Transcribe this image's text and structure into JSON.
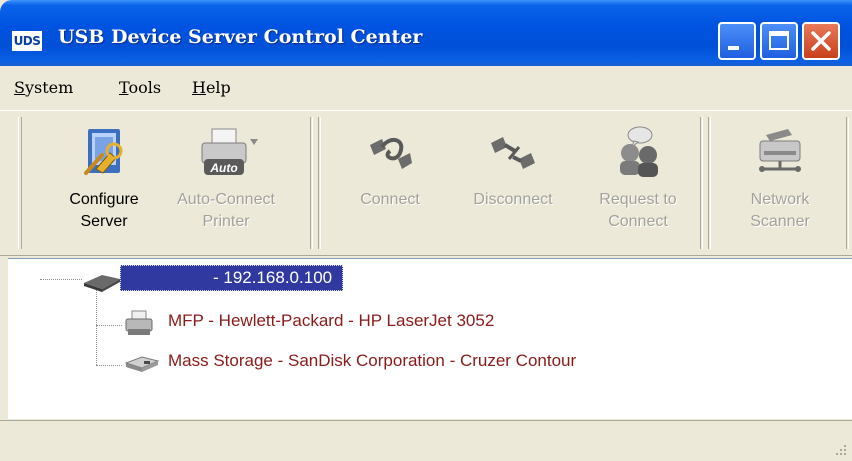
{
  "window": {
    "app_icon_text": "UDS",
    "title": "USB Device Server Control Center",
    "controls": {
      "minimize": "minimize-icon",
      "maximize": "maximize-icon",
      "close": "close-icon"
    }
  },
  "menu": {
    "items": [
      {
        "label": "System",
        "accel": "S",
        "rest": "ystem"
      },
      {
        "label": "Tools",
        "accel": "T",
        "rest": "ools"
      },
      {
        "label": "Help",
        "accel": "H",
        "rest": "elp"
      }
    ]
  },
  "toolbar": {
    "configure_server": {
      "line1": "Configure",
      "line2": "Server",
      "icon": "configure-server-icon",
      "enabled": true
    },
    "auto_connect_printer": {
      "line1": "Auto-Connect",
      "line2": "Printer",
      "icon_badge": "Auto",
      "enabled": false
    },
    "connect": {
      "line1": "Connect",
      "line2": "",
      "icon": "connect-icon",
      "enabled": false
    },
    "disconnect": {
      "line1": "Disconnect",
      "line2": "",
      "icon": "disconnect-icon",
      "enabled": false
    },
    "request_to_connect": {
      "line1": "Request to",
      "line2": "Connect",
      "icon": "request-connect-icon",
      "enabled": false
    },
    "network_scanner": {
      "line1": "Network",
      "line2": "Scanner",
      "icon": "scanner-icon",
      "enabled": false
    }
  },
  "tree": {
    "server": {
      "label": "- 192.168.0.100",
      "icon": "usb-server-icon",
      "selected": true
    },
    "devices": [
      {
        "label": "MFP - Hewlett-Packard - HP LaserJet 3052",
        "icon": "printer-icon"
      },
      {
        "label": "Mass Storage - SanDisk Corporation - Cruzer Contour",
        "icon": "storage-drive-icon"
      }
    ]
  },
  "colors": {
    "titlebar": "#0053e1",
    "selection": "#2f39a0",
    "device_text": "#8b1a1a",
    "disabled_text": "#a4a19a",
    "chrome": "#ece9d8"
  }
}
